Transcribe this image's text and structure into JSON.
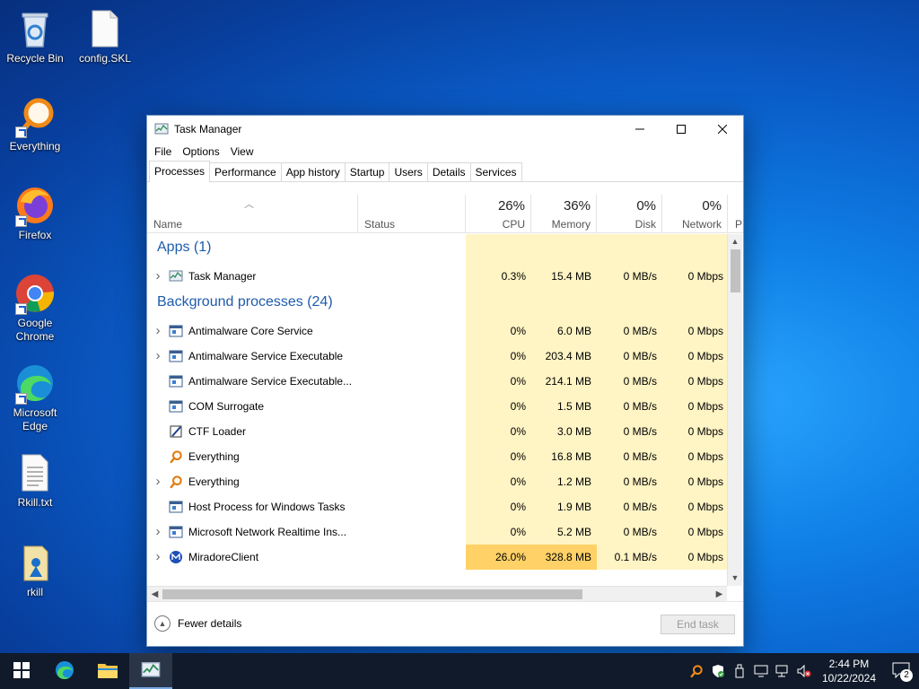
{
  "desktop": {
    "icons": [
      {
        "label": "Recycle Bin",
        "icon": "recycle-bin-icon"
      },
      {
        "label": "config.SKL",
        "icon": "file-icon"
      },
      {
        "label": "Everything",
        "icon": "everything-icon"
      },
      {
        "label": "Firefox",
        "icon": "firefox-icon"
      },
      {
        "label": "Google Chrome",
        "icon": "chrome-icon"
      },
      {
        "label": "Microsoft Edge",
        "icon": "edge-icon"
      },
      {
        "label": "Rkill.txt",
        "icon": "text-file-icon"
      },
      {
        "label": "rkill",
        "icon": "rkill-icon"
      }
    ]
  },
  "window": {
    "title": "Task Manager",
    "menu": [
      "File",
      "Options",
      "View"
    ],
    "tabs": [
      "Processes",
      "Performance",
      "App history",
      "Startup",
      "Users",
      "Details",
      "Services"
    ],
    "active_tab": "Processes",
    "columns": {
      "name": "Name",
      "status": "Status",
      "cpu": {
        "pct": "26%",
        "label": "CPU"
      },
      "memory": {
        "pct": "36%",
        "label": "Memory"
      },
      "disk": {
        "pct": "0%",
        "label": "Disk"
      },
      "network": {
        "pct": "0%",
        "label": "Network"
      },
      "power_partial": "P"
    },
    "groups": {
      "apps": "Apps (1)",
      "background": "Background processes (24)"
    },
    "apps": [
      {
        "name": "Task Manager",
        "icon": "task-manager-icon",
        "expandable": true,
        "cpu": "0.3%",
        "memory": "15.4 MB",
        "disk": "0 MB/s",
        "network": "0 Mbps"
      }
    ],
    "background": [
      {
        "name": "Antimalware Core Service",
        "icon": "service-icon",
        "expandable": true,
        "cpu": "0%",
        "memory": "6.0 MB",
        "disk": "0 MB/s",
        "network": "0 Mbps"
      },
      {
        "name": "Antimalware Service Executable",
        "icon": "service-icon",
        "expandable": true,
        "cpu": "0%",
        "memory": "203.4 MB",
        "disk": "0 MB/s",
        "network": "0 Mbps"
      },
      {
        "name": "Antimalware Service Executable...",
        "icon": "service-icon",
        "expandable": false,
        "cpu": "0%",
        "memory": "214.1 MB",
        "disk": "0 MB/s",
        "network": "0 Mbps"
      },
      {
        "name": "COM Surrogate",
        "icon": "service-icon",
        "expandable": false,
        "cpu": "0%",
        "memory": "1.5 MB",
        "disk": "0 MB/s",
        "network": "0 Mbps"
      },
      {
        "name": "CTF Loader",
        "icon": "ctf-loader-icon",
        "expandable": false,
        "cpu": "0%",
        "memory": "3.0 MB",
        "disk": "0 MB/s",
        "network": "0 Mbps"
      },
      {
        "name": "Everything",
        "icon": "everything-icon",
        "expandable": false,
        "cpu": "0%",
        "memory": "16.8 MB",
        "disk": "0 MB/s",
        "network": "0 Mbps"
      },
      {
        "name": "Everything",
        "icon": "everything-icon",
        "expandable": true,
        "cpu": "0%",
        "memory": "1.2 MB",
        "disk": "0 MB/s",
        "network": "0 Mbps"
      },
      {
        "name": "Host Process for Windows Tasks",
        "icon": "service-icon",
        "expandable": false,
        "cpu": "0%",
        "memory": "1.9 MB",
        "disk": "0 MB/s",
        "network": "0 Mbps"
      },
      {
        "name": "Microsoft Network Realtime Ins...",
        "icon": "service-icon",
        "expandable": true,
        "cpu": "0%",
        "memory": "5.2 MB",
        "disk": "0 MB/s",
        "network": "0 Mbps"
      },
      {
        "name": "MiradoreClient",
        "icon": "miradore-icon",
        "expandable": true,
        "cpu": "26.0%",
        "memory": "328.8 MB",
        "disk": "0.1 MB/s",
        "network": "0 Mbps",
        "hot": true
      }
    ],
    "footer": {
      "fewer_details": "Fewer details",
      "end_task": "End task"
    }
  },
  "taskbar": {
    "pinned": [
      "start-icon",
      "edge-icon",
      "file-explorer-icon",
      "task-manager-icon"
    ],
    "tray": [
      "everything-icon",
      "defender-icon",
      "usb-icon",
      "display-icon",
      "network-icon",
      "volume-muted-icon"
    ],
    "time": "2:44 PM",
    "date": "10/22/2024",
    "notification_count": "2"
  }
}
